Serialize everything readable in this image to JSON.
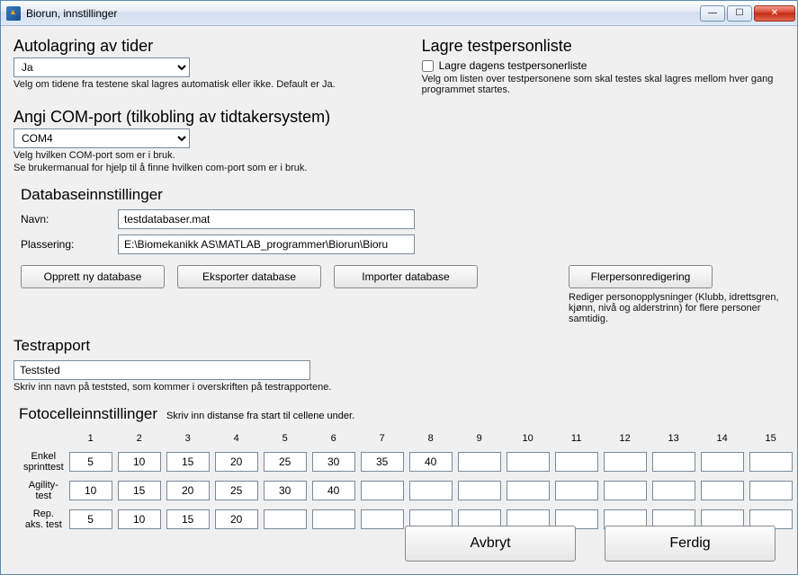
{
  "window": {
    "title": "Biorun, innstillinger"
  },
  "win_buttons": {
    "min": "—",
    "max": "☐",
    "close": "✕"
  },
  "autosave": {
    "heading": "Autolagring av tider",
    "value": "Ja",
    "help": "Velg om tidene fra testene skal lagres automatisk eller ikke. Default er Ja."
  },
  "savelist": {
    "heading": "Lagre testpersonliste",
    "checkbox_label": "Lagre dagens testpersonerliste",
    "help": "Velg om listen over testpersonene som skal testes skal lagres mellom hver gang programmet startes."
  },
  "comport": {
    "heading": "Angi COM-port (tilkobling av tidtakersystem)",
    "value": "COM4",
    "help1": "Velg hvilken COM-port som er i bruk.",
    "help2": "Se brukermanual for hjelp til å finne hvilken com-port som er i bruk."
  },
  "database": {
    "heading": "Databaseinnstillinger",
    "name_label": "Navn:",
    "name_value": "testdatabaser.mat",
    "path_label": "Plassering:",
    "path_value": "E:\\Biomekanikk AS\\MATLAB_programmer\\Biorun\\Bioru",
    "btn_create": "Opprett ny database",
    "btn_export": "Eksporter database",
    "btn_import": "Importer database"
  },
  "multiperson": {
    "btn": "Flerpersonredigering",
    "help": "Rediger personopplysninger (Klubb, idrettsgren, kjønn, nivå og alderstrinn) for flere personer samtidig."
  },
  "testreport": {
    "heading": "Testrapport",
    "value": "Teststed",
    "help": "Skriv inn navn på teststed, som kommer i overskriften på testrapportene."
  },
  "photocells": {
    "heading": "Fotocelleinnstillinger",
    "sub": "Skriv inn distanse fra start til cellene under.",
    "cols": [
      "1",
      "2",
      "3",
      "4",
      "5",
      "6",
      "7",
      "8",
      "9",
      "10",
      "11",
      "12",
      "13",
      "14",
      "15"
    ],
    "rows": [
      {
        "label": "Enkel sprinttest",
        "values": [
          "5",
          "10",
          "15",
          "20",
          "25",
          "30",
          "35",
          "40",
          "",
          "",
          "",
          "",
          "",
          "",
          ""
        ]
      },
      {
        "label": "Agility-\ntest",
        "values": [
          "10",
          "15",
          "20",
          "25",
          "30",
          "40",
          "",
          "",
          "",
          "",
          "",
          "",
          "",
          "",
          ""
        ]
      },
      {
        "label": "Rep. aks. test",
        "values": [
          "5",
          "10",
          "15",
          "20",
          "",
          "",
          "",
          "",
          "",
          "",
          "",
          "",
          "",
          "",
          ""
        ]
      }
    ]
  },
  "footer": {
    "cancel": "Avbryt",
    "ok": "Ferdig"
  }
}
